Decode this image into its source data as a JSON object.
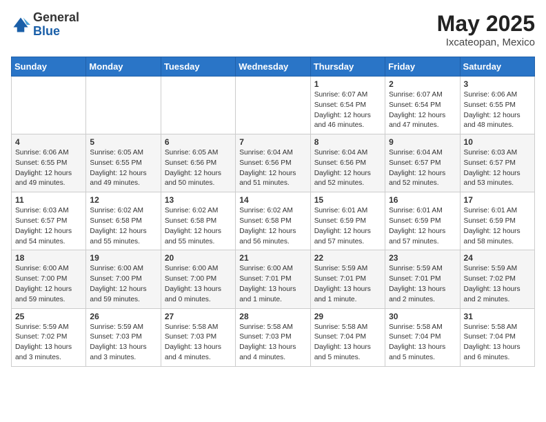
{
  "header": {
    "logo_line1": "General",
    "logo_line2": "Blue",
    "title": "May 2025",
    "subtitle": "Ixcateopan, Mexico"
  },
  "calendar": {
    "days_of_week": [
      "Sunday",
      "Monday",
      "Tuesday",
      "Wednesday",
      "Thursday",
      "Friday",
      "Saturday"
    ],
    "weeks": [
      [
        {
          "day": "",
          "info": ""
        },
        {
          "day": "",
          "info": ""
        },
        {
          "day": "",
          "info": ""
        },
        {
          "day": "",
          "info": ""
        },
        {
          "day": "1",
          "info": "Sunrise: 6:07 AM\nSunset: 6:54 PM\nDaylight: 12 hours\nand 46 minutes."
        },
        {
          "day": "2",
          "info": "Sunrise: 6:07 AM\nSunset: 6:54 PM\nDaylight: 12 hours\nand 47 minutes."
        },
        {
          "day": "3",
          "info": "Sunrise: 6:06 AM\nSunset: 6:55 PM\nDaylight: 12 hours\nand 48 minutes."
        }
      ],
      [
        {
          "day": "4",
          "info": "Sunrise: 6:06 AM\nSunset: 6:55 PM\nDaylight: 12 hours\nand 49 minutes."
        },
        {
          "day": "5",
          "info": "Sunrise: 6:05 AM\nSunset: 6:55 PM\nDaylight: 12 hours\nand 49 minutes."
        },
        {
          "day": "6",
          "info": "Sunrise: 6:05 AM\nSunset: 6:56 PM\nDaylight: 12 hours\nand 50 minutes."
        },
        {
          "day": "7",
          "info": "Sunrise: 6:04 AM\nSunset: 6:56 PM\nDaylight: 12 hours\nand 51 minutes."
        },
        {
          "day": "8",
          "info": "Sunrise: 6:04 AM\nSunset: 6:56 PM\nDaylight: 12 hours\nand 52 minutes."
        },
        {
          "day": "9",
          "info": "Sunrise: 6:04 AM\nSunset: 6:57 PM\nDaylight: 12 hours\nand 52 minutes."
        },
        {
          "day": "10",
          "info": "Sunrise: 6:03 AM\nSunset: 6:57 PM\nDaylight: 12 hours\nand 53 minutes."
        }
      ],
      [
        {
          "day": "11",
          "info": "Sunrise: 6:03 AM\nSunset: 6:57 PM\nDaylight: 12 hours\nand 54 minutes."
        },
        {
          "day": "12",
          "info": "Sunrise: 6:02 AM\nSunset: 6:58 PM\nDaylight: 12 hours\nand 55 minutes."
        },
        {
          "day": "13",
          "info": "Sunrise: 6:02 AM\nSunset: 6:58 PM\nDaylight: 12 hours\nand 55 minutes."
        },
        {
          "day": "14",
          "info": "Sunrise: 6:02 AM\nSunset: 6:58 PM\nDaylight: 12 hours\nand 56 minutes."
        },
        {
          "day": "15",
          "info": "Sunrise: 6:01 AM\nSunset: 6:59 PM\nDaylight: 12 hours\nand 57 minutes."
        },
        {
          "day": "16",
          "info": "Sunrise: 6:01 AM\nSunset: 6:59 PM\nDaylight: 12 hours\nand 57 minutes."
        },
        {
          "day": "17",
          "info": "Sunrise: 6:01 AM\nSunset: 6:59 PM\nDaylight: 12 hours\nand 58 minutes."
        }
      ],
      [
        {
          "day": "18",
          "info": "Sunrise: 6:00 AM\nSunset: 7:00 PM\nDaylight: 12 hours\nand 59 minutes."
        },
        {
          "day": "19",
          "info": "Sunrise: 6:00 AM\nSunset: 7:00 PM\nDaylight: 12 hours\nand 59 minutes."
        },
        {
          "day": "20",
          "info": "Sunrise: 6:00 AM\nSunset: 7:00 PM\nDaylight: 13 hours\nand 0 minutes."
        },
        {
          "day": "21",
          "info": "Sunrise: 6:00 AM\nSunset: 7:01 PM\nDaylight: 13 hours\nand 1 minute."
        },
        {
          "day": "22",
          "info": "Sunrise: 5:59 AM\nSunset: 7:01 PM\nDaylight: 13 hours\nand 1 minute."
        },
        {
          "day": "23",
          "info": "Sunrise: 5:59 AM\nSunset: 7:01 PM\nDaylight: 13 hours\nand 2 minutes."
        },
        {
          "day": "24",
          "info": "Sunrise: 5:59 AM\nSunset: 7:02 PM\nDaylight: 13 hours\nand 2 minutes."
        }
      ],
      [
        {
          "day": "25",
          "info": "Sunrise: 5:59 AM\nSunset: 7:02 PM\nDaylight: 13 hours\nand 3 minutes."
        },
        {
          "day": "26",
          "info": "Sunrise: 5:59 AM\nSunset: 7:03 PM\nDaylight: 13 hours\nand 3 minutes."
        },
        {
          "day": "27",
          "info": "Sunrise: 5:58 AM\nSunset: 7:03 PM\nDaylight: 13 hours\nand 4 minutes."
        },
        {
          "day": "28",
          "info": "Sunrise: 5:58 AM\nSunset: 7:03 PM\nDaylight: 13 hours\nand 4 minutes."
        },
        {
          "day": "29",
          "info": "Sunrise: 5:58 AM\nSunset: 7:04 PM\nDaylight: 13 hours\nand 5 minutes."
        },
        {
          "day": "30",
          "info": "Sunrise: 5:58 AM\nSunset: 7:04 PM\nDaylight: 13 hours\nand 5 minutes."
        },
        {
          "day": "31",
          "info": "Sunrise: 5:58 AM\nSunset: 7:04 PM\nDaylight: 13 hours\nand 6 minutes."
        }
      ]
    ]
  }
}
